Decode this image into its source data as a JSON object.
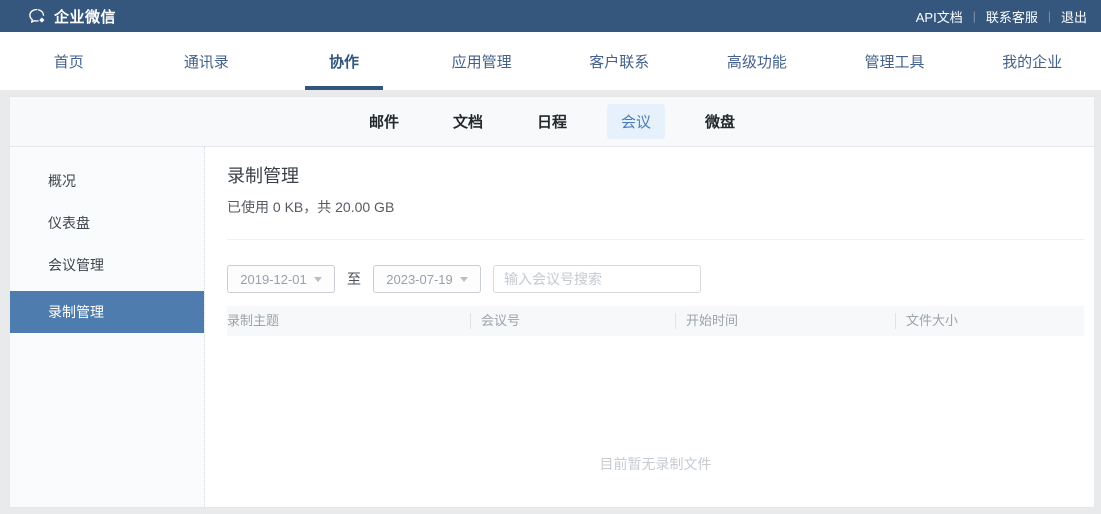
{
  "colors": {
    "topbar_bg": "#35577E",
    "nav_text": "#44618A",
    "nav_active_underline": "#31557E",
    "tab_active_bg": "#E7F1FC",
    "tab_active_text": "#4A7DB6",
    "sidebar_active_bg": "#4E7CAE",
    "page_bg": "#E9EAEC"
  },
  "topbar": {
    "brand": "企业微信",
    "separator": "|",
    "links": [
      {
        "label": "API文档"
      },
      {
        "label": "联系客服"
      },
      {
        "label": "退出"
      }
    ]
  },
  "nav": {
    "items": [
      {
        "label": "首页",
        "active": false
      },
      {
        "label": "通讯录",
        "active": false
      },
      {
        "label": "协作",
        "active": true
      },
      {
        "label": "应用管理",
        "active": false
      },
      {
        "label": "客户联系",
        "active": false
      },
      {
        "label": "高级功能",
        "active": false
      },
      {
        "label": "管理工具",
        "active": false
      },
      {
        "label": "我的企业",
        "active": false
      }
    ]
  },
  "subnav": {
    "tabs": [
      {
        "label": "邮件",
        "active": false
      },
      {
        "label": "文档",
        "active": false
      },
      {
        "label": "日程",
        "active": false
      },
      {
        "label": "会议",
        "active": true
      },
      {
        "label": "微盘",
        "active": false
      }
    ]
  },
  "sidebar": {
    "items": [
      {
        "label": "概况",
        "active": false
      },
      {
        "label": "仪表盘",
        "active": false
      },
      {
        "label": "会议管理",
        "active": false
      },
      {
        "label": "录制管理",
        "active": true
      }
    ]
  },
  "main": {
    "title": "录制管理",
    "usage_text": "已使用 0 KB，共 20.00 GB",
    "filters": {
      "date_from": "2019-12-01",
      "to_label": "至",
      "date_to": "2023-07-19",
      "search_placeholder": "输入会议号搜索"
    },
    "table": {
      "columns": [
        "录制主题",
        "会议号",
        "开始时间",
        "文件大小"
      ],
      "rows": []
    },
    "empty_text": "目前暂无录制文件"
  }
}
